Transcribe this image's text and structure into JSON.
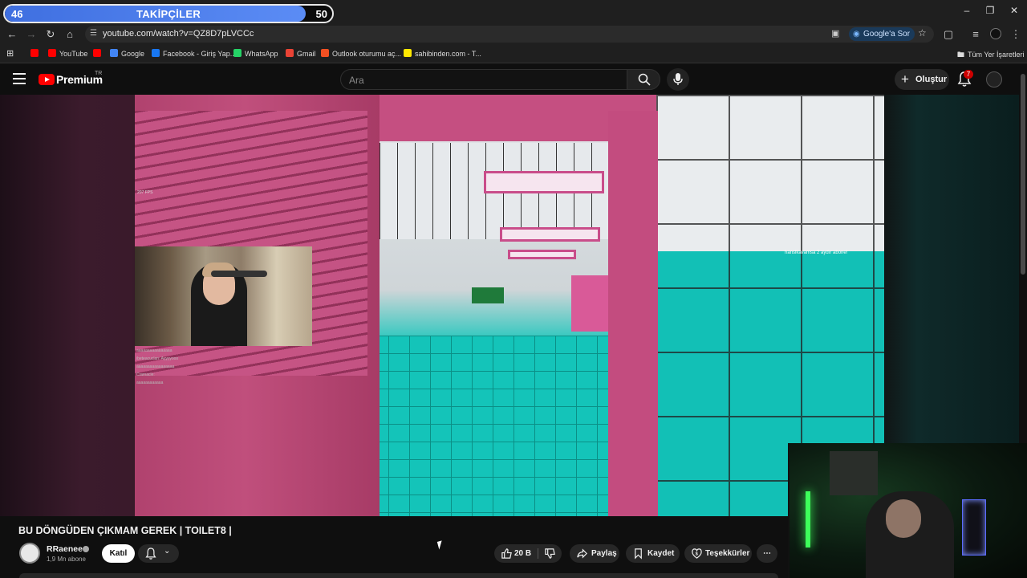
{
  "browser": {
    "follow_goal": {
      "current": "46",
      "title": "TAKİPÇİLER",
      "target": "50",
      "progress": 0.92
    },
    "url": "youtube.com/watch?v=QZ8D7pLVCCc",
    "ask_google": "Google'a Sor",
    "bookmarks": [
      {
        "label": "",
        "color": "#ff0000"
      },
      {
        "label": "YouTube",
        "color": "#ff0000"
      },
      {
        "label": "",
        "color": "#ff0000"
      },
      {
        "label": "Google",
        "color": "#4285f4"
      },
      {
        "label": "Facebook - Giriş Yap...",
        "color": "#1877f2"
      },
      {
        "label": "WhatsApp",
        "color": "#25d366"
      },
      {
        "label": "Gmail",
        "color": "#ea4335"
      },
      {
        "label": "Outlook oturumu aç...",
        "color": "#f25022"
      },
      {
        "label": "sahibinden.com - T...",
        "color": "#ffe800"
      }
    ],
    "all_bookmarks": "Tüm Yer İşaretleri"
  },
  "yt": {
    "brand": "Premium",
    "region": "TR",
    "search_placeholder": "Ara",
    "create_label": "Oluştur",
    "notif_count": "7"
  },
  "video": {
    "fps_overlay": "207 FPS",
    "sub_alert": "hanslkavamsa 2 aydır abone!",
    "chat_lines": [
      "aaaaaaaaaaaaaaaa",
      "ibeteacuclan: Ayyyyooo",
      "aaaaaaaaaaaaaaaaa",
      "Cramacle:",
      "aaaaaaaaaaaa"
    ]
  },
  "meta": {
    "title": "BU DÖNGÜDEN ÇIKMAM GEREK | TOILET8 |",
    "channel": "RRaenee",
    "subscribers": "1,9 Mn abone",
    "join_label": "Katıl",
    "likes": "20 B",
    "share_label": "Paylaş",
    "save_label": "Kaydet",
    "thanks_label": "Teşekkürler"
  }
}
